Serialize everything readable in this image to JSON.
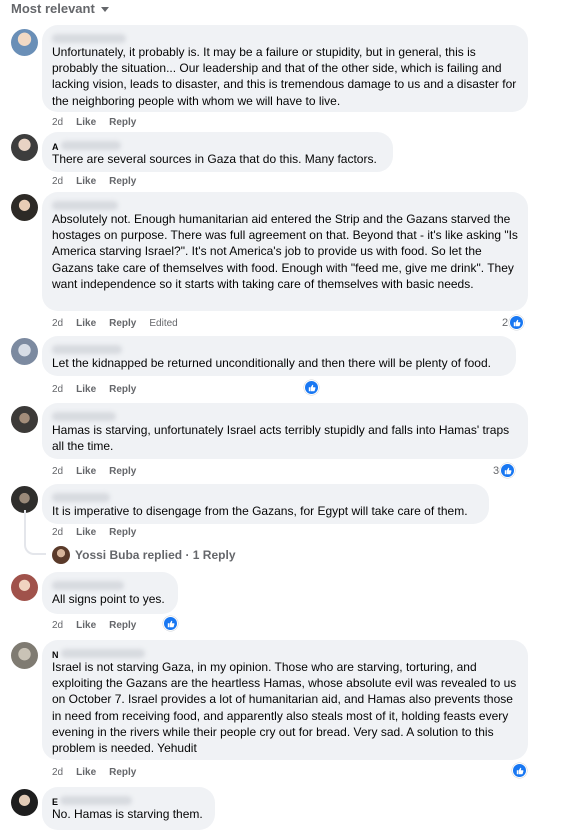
{
  "sort": {
    "label": "Most relevant"
  },
  "actions": {
    "like": "Like",
    "reply": "Reply",
    "edited": "Edited"
  },
  "comments": [
    {
      "time": "2d",
      "text": "Unfortunately, it probably is. It may be a failure or stupidity, but in general, this is probably the situation... Our leadership and that of the other side, which is failing and lacking vision, leads to disaster, and this is tremendous damage to us and a disaster for the neighboring people with whom we will have to live."
    },
    {
      "time": "2d",
      "author_initial": "A",
      "text": "There are several sources in Gaza that do this. Many factors."
    },
    {
      "time": "2d",
      "text": "Absolutely not. Enough humanitarian aid entered the Strip and the Gazans starved the hostages on purpose. There was full agreement on that. Beyond that - it's like asking \"Is America starving Israel?\". It's not America's job to provide us with food. So let the Gazans take care of themselves with food. Enough with \"feed me, give me drink\". They want independence so it starts with taking care of themselves with basic needs.",
      "reactions": "2"
    },
    {
      "time": "2d",
      "text": "Let the kidnapped be returned unconditionally and then there will be plenty of food."
    },
    {
      "time": "2d",
      "text": "Hamas is starving, unfortunately Israel acts terribly stupidly and falls into Hamas' traps all the time.",
      "reactions": "3"
    },
    {
      "time": "2d",
      "text": "It is imperative to disengage from the Gazans, for Egypt will take care of them."
    },
    {
      "time": "2d",
      "text": "All signs point to yes."
    },
    {
      "time": "2d",
      "author_initial": "N",
      "text": "Israel is not starving Gaza, in my opinion. Those who are starving, torturing, and exploiting the Gazans are the heartless Hamas, whose absolute evil was revealed to us on October 7. Israel provides a lot of humanitarian aid, and Hamas also prevents those in need from receiving food, and apparently also steals most of it, holding feasts every evening in the rivers while their people cry out for bread. Very sad. A solution to this problem is needed. Yehudit"
    },
    {
      "author_initial": "E",
      "text": "No. Hamas is starving them."
    }
  ],
  "replies_link": "Yossi Buba replied · 1 Reply",
  "colors": {
    "bubble": "#f0f2f5",
    "meta": "#65676b",
    "like_blue": "#1877f2"
  }
}
